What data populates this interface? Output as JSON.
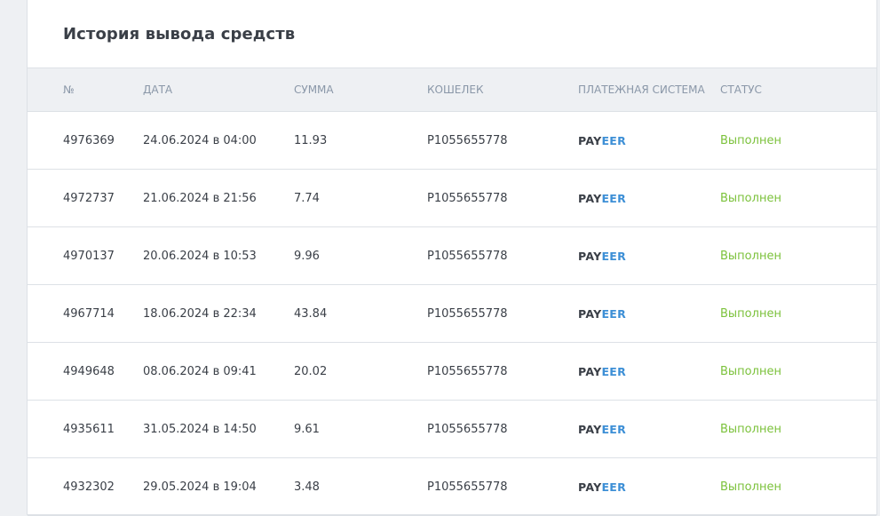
{
  "title": "История вывода средств",
  "columns": [
    "№",
    "Дата",
    "Сумма",
    "Кошелек",
    "Платежная система",
    "Статус"
  ],
  "colors": {
    "status_done": "#7cc23c",
    "payeer_dark": "#3a3f47",
    "payeer_blue": "#3d8fd6"
  },
  "payment_logo": {
    "part1": "PAY",
    "part2": "EER",
    "icon": "payeer-logo"
  },
  "rows": [
    {
      "id": "4976369",
      "date": "24.06.2024 в 04:00",
      "amount": "11.93",
      "wallet": "P1055655778",
      "status": "Выполнен"
    },
    {
      "id": "4972737",
      "date": "21.06.2024 в 21:56",
      "amount": "7.74",
      "wallet": "P1055655778",
      "status": "Выполнен"
    },
    {
      "id": "4970137",
      "date": "20.06.2024 в 10:53",
      "amount": "9.96",
      "wallet": "P1055655778",
      "status": "Выполнен"
    },
    {
      "id": "4967714",
      "date": "18.06.2024 в 22:34",
      "amount": "43.84",
      "wallet": "P1055655778",
      "status": "Выполнен"
    },
    {
      "id": "4949648",
      "date": "08.06.2024 в 09:41",
      "amount": "20.02",
      "wallet": "P1055655778",
      "status": "Выполнен"
    },
    {
      "id": "4935611",
      "date": "31.05.2024 в 14:50",
      "amount": "9.61",
      "wallet": "P1055655778",
      "status": "Выполнен"
    },
    {
      "id": "4932302",
      "date": "29.05.2024 в 19:04",
      "amount": "3.48",
      "wallet": "P1055655778",
      "status": "Выполнен"
    }
  ]
}
